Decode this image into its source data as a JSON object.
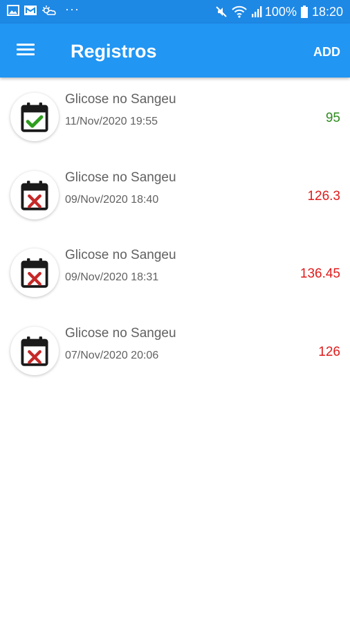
{
  "status_bar": {
    "battery_text": "100%",
    "time": "18:20",
    "dots": "···",
    "icons": [
      "gallery-icon",
      "photo-message-icon",
      "weather-icon",
      "mute-icon",
      "wifi-icon",
      "signal-icon",
      "battery-icon"
    ]
  },
  "app_bar": {
    "title": "Registros",
    "add_label": "ADD",
    "menu_icon": "hamburger-menu-icon",
    "color": "#2196F3"
  },
  "records": [
    {
      "title": "Glicose no Sangeu",
      "date": "11/Nov/2020 19:55",
      "value": "95",
      "status": "ok",
      "icon": "calendar-check-icon",
      "value_color": "#2E8B1E"
    },
    {
      "title": "Glicose no Sangeu",
      "date": "09/Nov/2020 18:40",
      "value": "126.3",
      "status": "high",
      "icon": "calendar-x-icon",
      "value_color": "#E01B1B"
    },
    {
      "title": "Glicose no Sangeu",
      "date": "09/Nov/2020 18:31",
      "value": "136.45",
      "status": "high",
      "icon": "calendar-x-icon",
      "value_color": "#E01B1B"
    },
    {
      "title": "Glicose no Sangeu",
      "date": "07/Nov/2020 20:06",
      "value": "126",
      "status": "high",
      "icon": "calendar-x-icon",
      "value_color": "#E01B1B"
    }
  ]
}
